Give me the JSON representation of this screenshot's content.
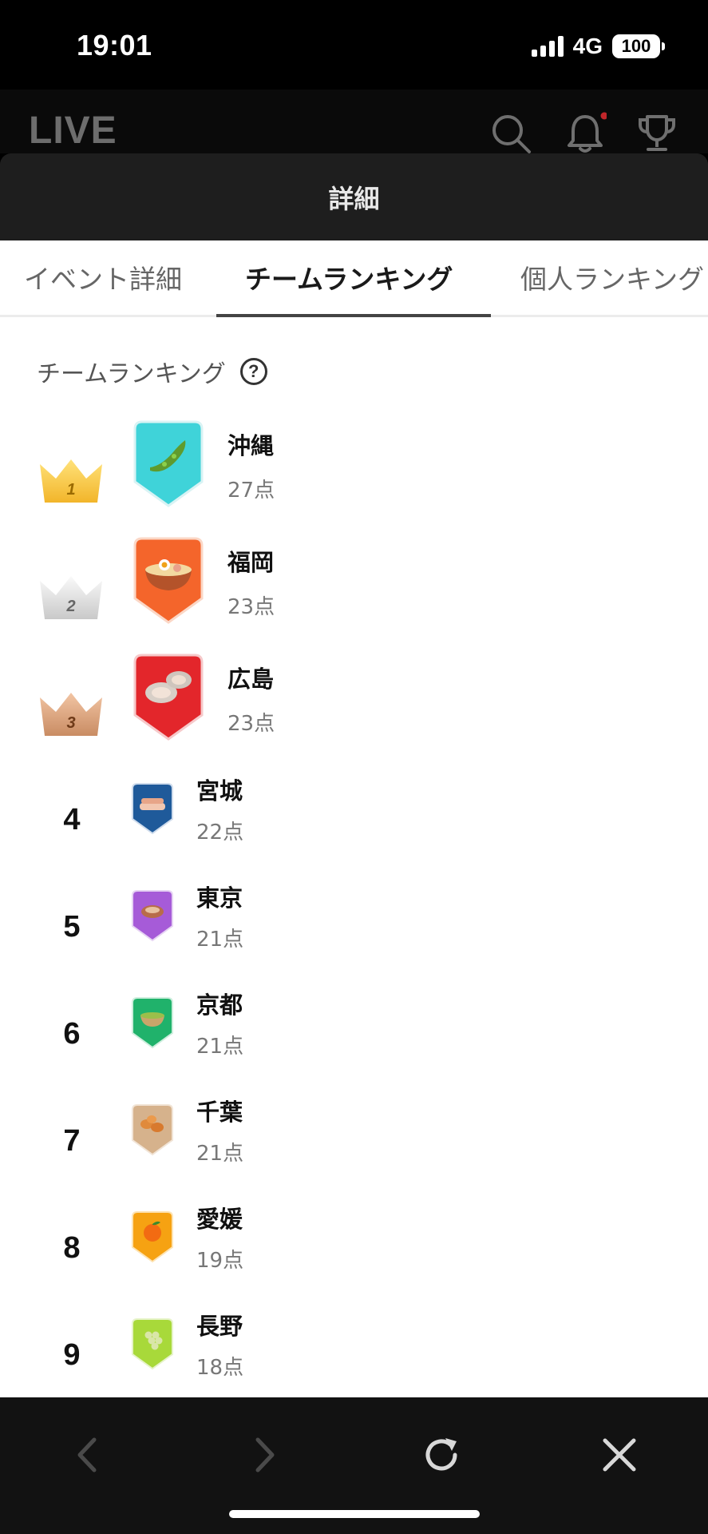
{
  "status": {
    "time": "19:01",
    "network": "4G",
    "battery": "100"
  },
  "app": {
    "logo": "LIVE",
    "icons": [
      "search-icon",
      "bell-icon",
      "trophy-icon"
    ]
  },
  "sheet": {
    "title": "詳細"
  },
  "tabs": [
    {
      "label": "イベント詳細",
      "active": false
    },
    {
      "label": "チームランキング",
      "active": true
    },
    {
      "label": "個人ランキング",
      "active": false
    }
  ],
  "ranking": {
    "section_title": "チームランキング",
    "help_icon": "?",
    "crown_numbers": [
      "1",
      "2",
      "3"
    ],
    "items": [
      {
        "rank": "1",
        "name": "沖縄",
        "score": "27点",
        "badge_color": "#3fd3d9",
        "icon": "goya-icon"
      },
      {
        "rank": "2",
        "name": "福岡",
        "score": "23点",
        "badge_color": "#f4652b",
        "icon": "ramen-icon"
      },
      {
        "rank": "3",
        "name": "広島",
        "score": "23点",
        "badge_color": "#e3262b",
        "icon": "oyster-icon"
      },
      {
        "rank": "4",
        "name": "宮城",
        "score": "22点",
        "badge_color": "#1f5a9a",
        "icon": "gyutan-icon"
      },
      {
        "rank": "5",
        "name": "東京",
        "score": "21点",
        "badge_color": "#a65bd8",
        "icon": "monja-icon"
      },
      {
        "rank": "6",
        "name": "京都",
        "score": "21点",
        "badge_color": "#20b26b",
        "icon": "matcha-icon"
      },
      {
        "rank": "7",
        "name": "千葉",
        "score": "21点",
        "badge_color": "#d6b28c",
        "icon": "peanut-icon"
      },
      {
        "rank": "8",
        "name": "愛媛",
        "score": "19点",
        "badge_color": "#f6a212",
        "icon": "mikan-icon"
      },
      {
        "rank": "9",
        "name": "長野",
        "score": "18点",
        "badge_color": "#a8d93a",
        "icon": "grape-icon"
      }
    ]
  },
  "toolbar": {
    "buttons": [
      "back-icon",
      "forward-icon",
      "reload-icon",
      "close-icon"
    ]
  }
}
